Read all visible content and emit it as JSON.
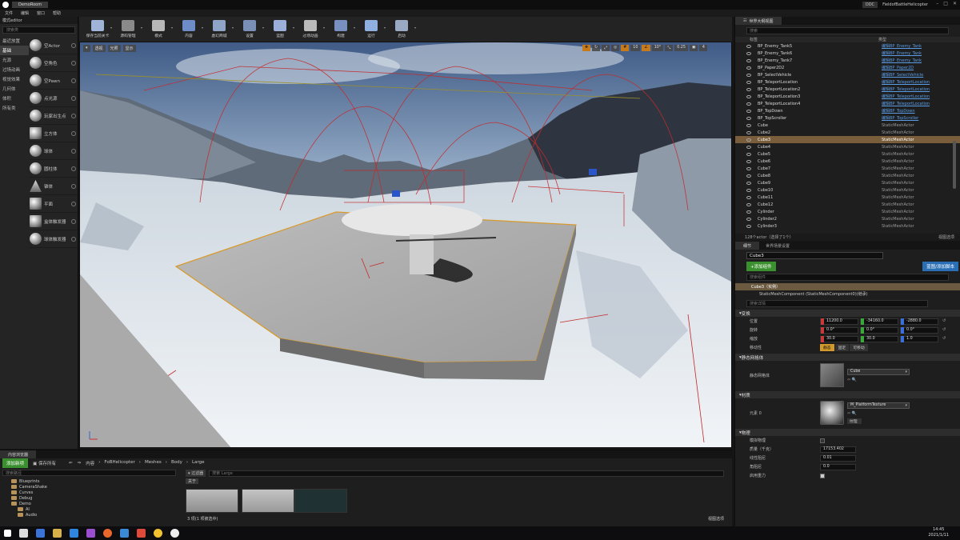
{
  "window": {
    "tab_title": "DemoRoom",
    "user_badge": "DDC",
    "project_name": "FieldofBattleHelicopter"
  },
  "menu": [
    "文件",
    "编辑",
    "窗口",
    "帮助"
  ],
  "modes_panel": {
    "tab": "模式editor",
    "search_placeholder": "搜索类",
    "categories": [
      {
        "label": "最近放置",
        "selected": false
      },
      {
        "label": "基础",
        "selected": true
      },
      {
        "label": "光源",
        "selected": false
      },
      {
        "label": "过场动画",
        "selected": false
      },
      {
        "label": "视觉效果",
        "selected": false
      },
      {
        "label": "几何体",
        "selected": false
      },
      {
        "label": "体积",
        "selected": false
      },
      {
        "label": "所有类",
        "selected": false
      }
    ],
    "items": [
      {
        "label": "空Actor",
        "icon": "sphere-icon"
      },
      {
        "label": "空角色",
        "icon": "character-icon"
      },
      {
        "label": "空Pawn",
        "icon": "pawn-icon"
      },
      {
        "label": "点光源",
        "icon": "point-light-icon"
      },
      {
        "label": "玩家出生点",
        "icon": "player-start-icon"
      },
      {
        "label": "立方体",
        "icon": "cube-icon"
      },
      {
        "label": "球体",
        "icon": "sphere-icon"
      },
      {
        "label": "圆柱体",
        "icon": "cylinder-icon"
      },
      {
        "label": "锥体",
        "icon": "cone-icon"
      },
      {
        "label": "平面",
        "icon": "plane-icon"
      },
      {
        "label": "盒体触发器",
        "icon": "box-trigger-icon"
      },
      {
        "label": "球体触发器",
        "icon": "sphere-trigger-icon"
      }
    ]
  },
  "toolbar": [
    {
      "label": "保存当前关卡",
      "icon": "save-icon",
      "color": "#9fb4d6"
    },
    {
      "label": "源码管理",
      "icon": "source-control-icon",
      "color": "#8a8a8a"
    },
    {
      "label": "模式",
      "icon": "modes-icon",
      "color": "#b7b7b7"
    },
    {
      "label": "内容",
      "icon": "content-icon",
      "color": "#6d8cc8"
    },
    {
      "label": "虚幻商城",
      "icon": "marketplace-icon",
      "color": "#8fa5c8"
    },
    {
      "label": "设置",
      "icon": "settings-icon",
      "color": "#7a8fb5"
    },
    {
      "label": "蓝图",
      "icon": "blueprint-icon",
      "color": "#9ab0d8"
    },
    {
      "label": "过场动画",
      "icon": "cinematics-icon",
      "color": "#bbbbbb"
    },
    {
      "label": "构建",
      "icon": "build-icon",
      "color": "#7790c0"
    },
    {
      "label": "运行",
      "icon": "play-icon",
      "color": "#8fb0e0"
    },
    {
      "label": "启动",
      "icon": "launch-icon",
      "color": "#9aa9c4"
    }
  ],
  "viewport": {
    "left_buttons": [
      "透视",
      "光照",
      "显示"
    ],
    "right_values": [
      "10",
      "10°",
      "0.25",
      "4"
    ]
  },
  "outliner": {
    "tab": "世界大纲视图",
    "search_placeholder": "搜索",
    "col_label": "标签",
    "col_type": "类型",
    "rows": [
      {
        "name": "BP_Enemy_Tank5",
        "type": "编辑BP_Enemy_Tank",
        "link": true,
        "selected": false
      },
      {
        "name": "BP_Enemy_Tank6",
        "type": "编辑BP_Enemy_Tank",
        "link": true,
        "selected": false
      },
      {
        "name": "BP_Enemy_Tank7",
        "type": "编辑BP_Enemy_Tank",
        "link": true,
        "selected": false
      },
      {
        "name": "BP_Paper2D2",
        "type": "编辑BP_Paper2D",
        "link": true,
        "selected": false
      },
      {
        "name": "BP_SelectVehicle",
        "type": "编辑BP_SelectVehicle",
        "link": true,
        "selected": false
      },
      {
        "name": "BP_TeleportLocation",
        "type": "编辑BP_TeleportLocation",
        "link": true,
        "selected": false
      },
      {
        "name": "BP_TeleportLocation2",
        "type": "编辑BP_TeleportLocation",
        "link": true,
        "selected": false
      },
      {
        "name": "BP_TeleportLocation3",
        "type": "编辑BP_TeleportLocation",
        "link": true,
        "selected": false
      },
      {
        "name": "BP_TeleportLocation4",
        "type": "编辑BP_TeleportLocation",
        "link": true,
        "selected": false
      },
      {
        "name": "BP_TopDown",
        "type": "编辑BP_TopDown",
        "link": true,
        "selected": false
      },
      {
        "name": "BP_TopScroller",
        "type": "编辑BP_TopScroller",
        "link": true,
        "selected": false
      },
      {
        "name": "Cube",
        "type": "StaticMeshActor",
        "link": false,
        "selected": false
      },
      {
        "name": "Cube2",
        "type": "StaticMeshActor",
        "link": false,
        "selected": false
      },
      {
        "name": "Cube3",
        "type": "StaticMeshActor",
        "link": false,
        "selected": true
      },
      {
        "name": "Cube4",
        "type": "StaticMeshActor",
        "link": false,
        "selected": false
      },
      {
        "name": "Cube5",
        "type": "StaticMeshActor",
        "link": false,
        "selected": false
      },
      {
        "name": "Cube6",
        "type": "StaticMeshActor",
        "link": false,
        "selected": false
      },
      {
        "name": "Cube7",
        "type": "StaticMeshActor",
        "link": false,
        "selected": false
      },
      {
        "name": "Cube8",
        "type": "StaticMeshActor",
        "link": false,
        "selected": false
      },
      {
        "name": "Cube9",
        "type": "StaticMeshActor",
        "link": false,
        "selected": false
      },
      {
        "name": "Cube10",
        "type": "StaticMeshActor",
        "link": false,
        "selected": false
      },
      {
        "name": "Cube11",
        "type": "StaticMeshActor",
        "link": false,
        "selected": false
      },
      {
        "name": "Cube12",
        "type": "StaticMeshActor",
        "link": false,
        "selected": false
      },
      {
        "name": "Cylinder",
        "type": "StaticMeshActor",
        "link": false,
        "selected": false
      },
      {
        "name": "Cylinder2",
        "type": "StaticMeshActor",
        "link": false,
        "selected": false
      },
      {
        "name": "Cylinder3",
        "type": "StaticMeshActor",
        "link": false,
        "selected": false
      }
    ],
    "footer_count": "128个actor（选择了1个）",
    "footer_view": "视图选项"
  },
  "details": {
    "tab": "细节",
    "tab2": "世界场景设置",
    "actor_name": "Cube3",
    "add_component": "+添加组件",
    "blueprint_button": "蓝图/添加脚本",
    "component_search_placeholder": "搜索组件",
    "root_component": "Cube3（实例）",
    "child_component": "StaticMeshComponent (StaticMeshComponent0)(继承)",
    "detail_search_placeholder": "搜索详情",
    "transform_section": "变换",
    "location_label": "位置",
    "location": [
      "11200.0",
      "-34160.0",
      "-2880.0"
    ],
    "rotation_label": "旋转",
    "rotation": [
      "0.0°",
      "0.0°",
      "0.0°"
    ],
    "scale_label": "缩放",
    "scale": [
      "30.0",
      "30.0",
      "1.0"
    ],
    "mobility_label": "移动性",
    "mobility_options": [
      "静态",
      "固定",
      "可移动"
    ],
    "staticmesh_section": "静态网格体",
    "staticmesh_label": "静态网格体",
    "staticmesh_value": "Cube",
    "materials_section": "材质",
    "element_label": "元素 0",
    "material_value": "M_PlatformTexture",
    "material_sub": "纹理",
    "physics_section": "物理",
    "physics": [
      {
        "label": "模拟物理",
        "type": "check",
        "value": false
      },
      {
        "label": "质量（千克）",
        "type": "num",
        "value": "17153.402"
      },
      {
        "label": "线性阻尼",
        "type": "num",
        "value": "0.01"
      },
      {
        "label": "角阻尼",
        "type": "num",
        "value": "0.0"
      },
      {
        "label": "启用重力",
        "type": "check",
        "value": true
      }
    ]
  },
  "content_browser": {
    "tab": "内容浏览器",
    "add_new": "添加新项",
    "save_all": "保存所有",
    "breadcrumb": [
      "内容",
      "FoBHelicopter",
      "Meshes",
      "Body",
      "Large"
    ],
    "folder_search_placeholder": "搜索路径",
    "asset_search_placeholder": "搜索 Large",
    "filter_label": "过滤器",
    "tag_label": "关于",
    "folders": [
      "Blueprints",
      "CameraShake",
      "Curves",
      "Debug",
      "Demo",
      "AI",
      "Audio"
    ],
    "status": "3 项(1 项被选中)",
    "view_options": "视图选项"
  },
  "taskbar": {
    "time": "14:45",
    "date": "2021/1/11"
  }
}
